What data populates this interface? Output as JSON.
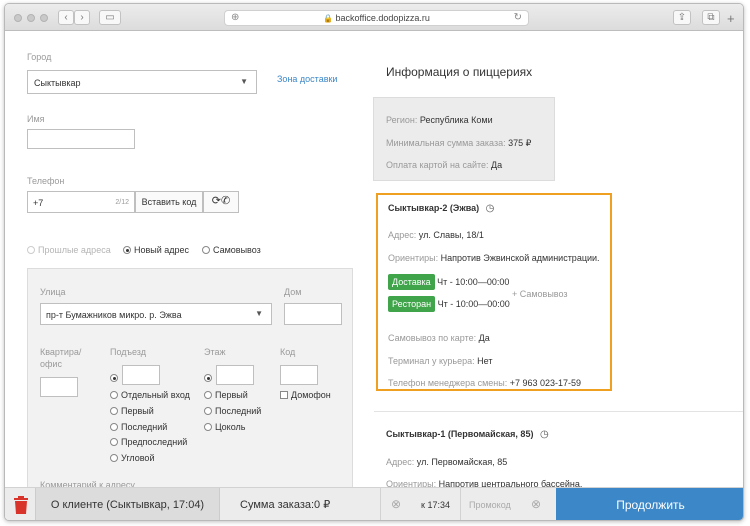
{
  "browser": {
    "url": "backoffice.dodopizza.ru"
  },
  "form": {
    "city": {
      "label": "Город",
      "value": "Сыктывкар"
    },
    "delivery_zone_link": "Зона доставки",
    "name": {
      "label": "Имя",
      "value": ""
    },
    "phone": {
      "label": "Телефон",
      "value": "+7",
      "counter": "2/12",
      "paste_button": "Вставить код"
    },
    "address_modes": {
      "past": "Прошлые адреса",
      "new": "Новый адрес",
      "pickup": "Самовывоз"
    },
    "address": {
      "street_label": "Улица",
      "street_value": "пр-т Бумажников микро. р. Эжва",
      "house_label": "Дом",
      "apartment_label": "Квартира/",
      "apartment_label2": "офис",
      "entrance_label": "Подъезд",
      "entrance_options": [
        "Отдельный вход",
        "Первый",
        "Последний",
        "Предпоследний",
        "Угловой"
      ],
      "floor_label": "Этаж",
      "floor_options": [
        "Первый",
        "Последний",
        "Цоколь"
      ],
      "code_label": "Код",
      "intercom_label": "Домофон",
      "comment_label": "Комментарий к адресу"
    }
  },
  "info": {
    "title": "Информация о пиццериях",
    "region": {
      "label": "Регион:",
      "value": "Республика Коми"
    },
    "min_order": {
      "label": "Минимальная сумма заказа:",
      "value": "375 ₽"
    },
    "card_payment": {
      "label": "Оплата картой на сайте:",
      "value": "Да"
    },
    "pizzerias": [
      {
        "name": "Сыктывкар-2 (Эжва)",
        "address_label": "Адрес:",
        "address": "ул. Славы, 18/1",
        "landmarks_label": "Ориентиры:",
        "landmarks": "Напротив Эжвинской администрации.",
        "delivery_tag": "Доставка",
        "delivery_hours": "Чт - 10:00—00:00",
        "restaurant_tag": "Ресторан",
        "restaurant_hours": "Чт - 10:00—00:00",
        "pickup_note": "+ Самовывоз",
        "card_pickup_label": "Самовывоз по карте:",
        "card_pickup": "Да",
        "courier_terminal_label": "Терминал у курьера:",
        "courier_terminal": "Нет",
        "manager_phone_label": "Телефон менеджера смены:",
        "manager_phone": "+7 963 023-17-59"
      },
      {
        "name": "Сыктывкар-1 (Первомайская, 85)",
        "address_label": "Адрес:",
        "address": "ул. Первомайская, 85",
        "landmarks_label": "Ориентиры:",
        "landmarks": "Напротив центрального бассейна."
      }
    ]
  },
  "bottom_bar": {
    "client": "О клиенте (Сыктывкар, 17:04)",
    "order_sum": "Сумма заказа:0 ₽",
    "time": "к 17:34",
    "promo_placeholder": "Промокод",
    "continue": "Продолжить"
  },
  "colors": {
    "accent": "#f0a020",
    "green": "#3fa44a",
    "blue": "#3c87c8",
    "trash": "#d9342b"
  }
}
